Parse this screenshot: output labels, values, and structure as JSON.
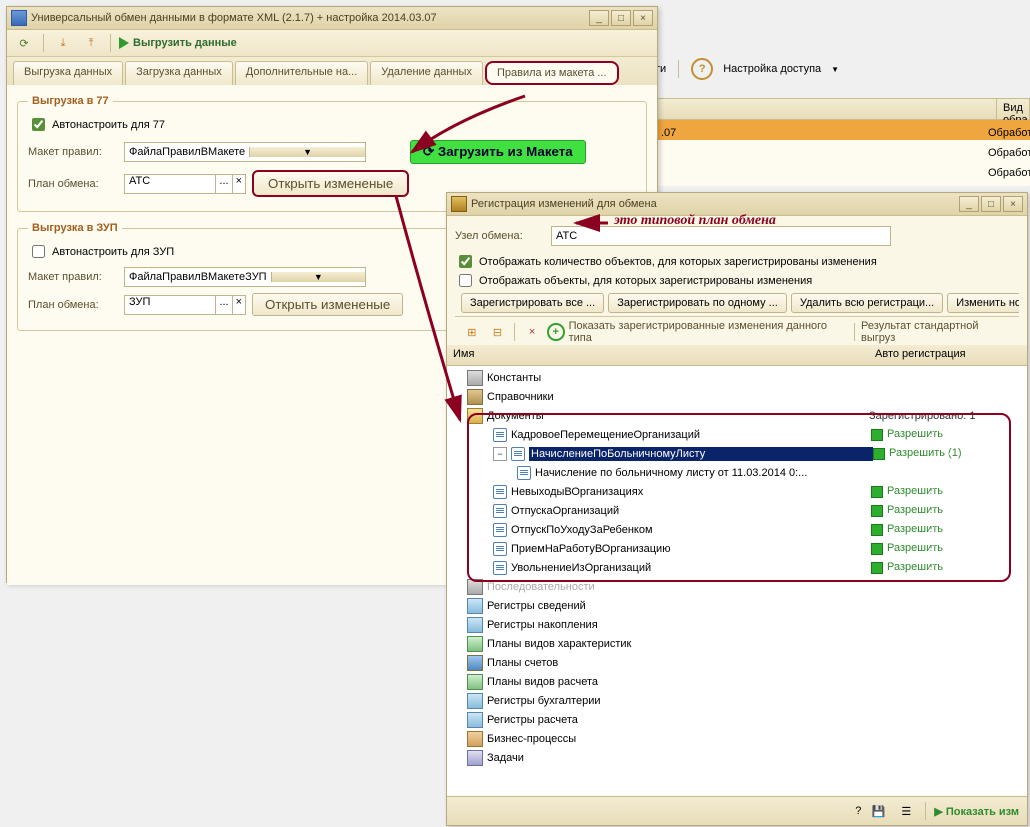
{
  "bg": {
    "menu": [
      "ти",
      "Настройка доступа"
    ],
    "col2": "Вид обра",
    "rows": [
      ".07",
      "Обработк",
      "Обработк",
      "Обработк"
    ]
  },
  "win1": {
    "title": "Универсальный обмен данными в формате XML (2.1.7) + настройка 2014.03.07",
    "action": "Выгрузить данные",
    "tabs": [
      "Выгрузка данных",
      "Загрузка данных",
      "Дополнительные на...",
      "Удаление данных",
      "Правила из макета ..."
    ],
    "g1": {
      "legend": "Выгрузка в 77",
      "auto": "Автонастроить для 77",
      "maket_lbl": "Макет правил:",
      "maket_val": "ФайлаПравилВМакете",
      "plan_lbl": "План обмена:",
      "plan_val": "АТС",
      "open": "Открыть измененые",
      "load": "Загрузить из Макета"
    },
    "g2": {
      "legend": "Выгрузка в ЗУП",
      "auto": "Автонастроить для ЗУП",
      "maket_lbl": "Макет правил:",
      "maket_val": "ФайлаПравилВМакетеЗУП",
      "plan_lbl": "План обмена:",
      "plan_val": "ЗУП",
      "open": "Открыть измененые"
    }
  },
  "annot": "это типовой план обмена",
  "win2": {
    "title": "Регистрация изменений для обмена",
    "node_lbl": "Узел обмена:",
    "node_val": "АТС",
    "chk1": "Отображать количество объектов, для которых зарегистрированы изменения",
    "chk2": "Отображать объекты, для которых зарегистрированы изменения",
    "btns": [
      "Зарегистрировать все ...",
      "Зарегистрировать по одному ...",
      "Удалить всю регистраци...",
      "Изменить но"
    ],
    "show": "Показать зарегистрированные изменения данного типа",
    "result": "Результат стандартной выгруз",
    "cols": [
      "Имя",
      "Авто регистрация"
    ],
    "reg": "Зарегистрировано: 1",
    "permit": "Разрешить",
    "permit1": "Разрешить (1)",
    "tree": {
      "root": [
        "Константы",
        "Справочники",
        "Документы"
      ],
      "docs": [
        "КадровоеПеремещениеОрганизаций",
        "НачислениеПоБольничномуЛисту",
        "Начисление по больничному листу                      от 11.03.2014 0:...",
        "НевыходыВОрганизациях",
        "ОтпускаОрганизаций",
        "ОтпускПоУходуЗаРебенком",
        "ПриемНаРаботуВОрганизацию",
        "УвольнениеИзОрганизаций"
      ],
      "rest": [
        "Последовательности",
        "Регистры сведений",
        "Регистры накопления",
        "Планы видов характеристик",
        "Планы счетов",
        "Планы видов расчета",
        "Регистры бухгалтерии",
        "Регистры расчета",
        "Бизнес-процессы",
        "Задачи"
      ]
    },
    "footer_btn": "Показать изм"
  }
}
